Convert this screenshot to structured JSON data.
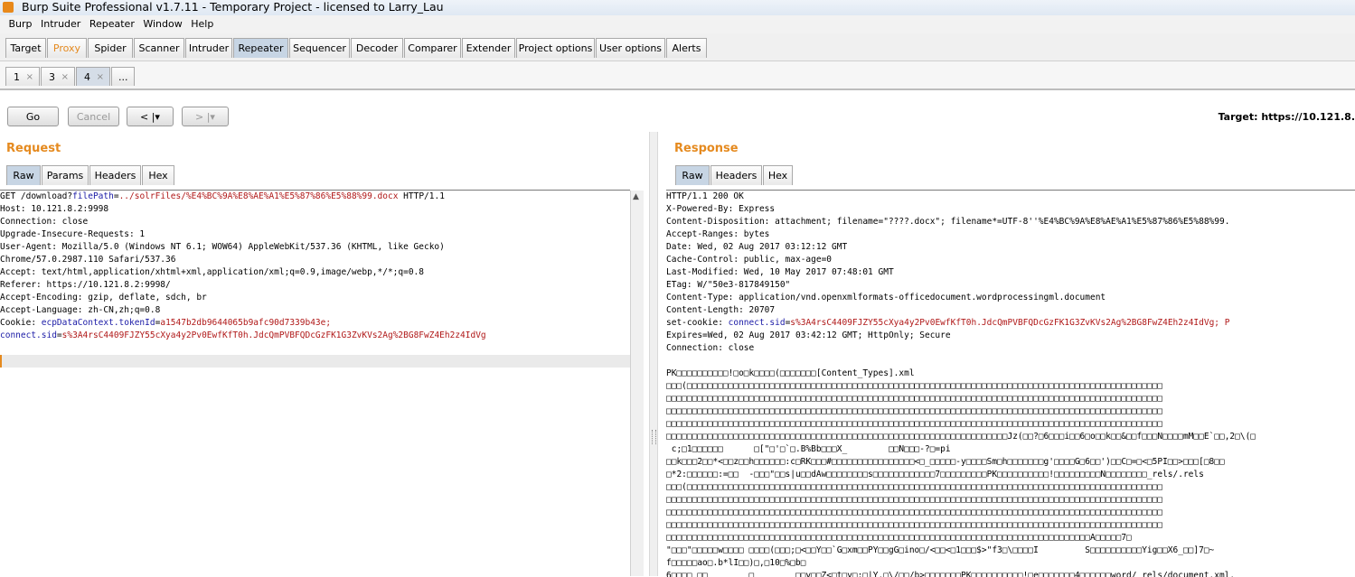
{
  "window": {
    "title": "Burp Suite Professional v1.7.11 - Temporary Project - licensed to Larry_Lau"
  },
  "menu": [
    "Burp",
    "Intruder",
    "Repeater",
    "Window",
    "Help"
  ],
  "main_tabs": [
    "Target",
    "Proxy",
    "Spider",
    "Scanner",
    "Intruder",
    "Repeater",
    "Sequencer",
    "Decoder",
    "Comparer",
    "Extender",
    "Project options",
    "User options",
    "Alerts"
  ],
  "sub_tabs": [
    "1",
    "3",
    "4",
    "..."
  ],
  "sub_tab_close": "×",
  "toolbar": {
    "go_label": "Go",
    "cancel_label": "Cancel",
    "back_label": "< |▾",
    "forward_label": "> |▾",
    "target_label": "Target: https://10.121.8."
  },
  "request": {
    "title": "Request",
    "tabs": [
      "Raw",
      "Params",
      "Headers",
      "Hex"
    ],
    "lines": [
      [
        "GET /download?",
        "filePath",
        "=",
        "../solrFiles/%E4%BC%9A%E8%AE%A1%E5%87%86%E5%88%99.docx",
        " HTTP/1.1"
      ],
      [
        "Host: 10.121.8.2:9998"
      ],
      [
        "Connection: close"
      ],
      [
        "Upgrade-Insecure-Requests: 1"
      ],
      [
        "User-Agent: Mozilla/5.0 (Windows NT 6.1; WOW64) AppleWebKit/537.36 (KHTML, like Gecko)"
      ],
      [
        "Chrome/57.0.2987.110 Safari/537.36"
      ],
      [
        "Accept: text/html,application/xhtml+xml,application/xml;q=0.9,image/webp,*/*;q=0.8"
      ],
      [
        "Referer: https://10.121.8.2:9998/"
      ],
      [
        "Accept-Encoding: gzip, deflate, sdch, br"
      ],
      [
        "Accept-Language: zh-CN,zh;q=0.8"
      ],
      [
        "Cookie: ",
        "ecpDataContext.tokenId",
        "=",
        "a1547b2db9644065b9afc90d7339b43e;"
      ],
      [
        "",
        "connect.sid",
        "=",
        "s%3A4rsC4409FJZY55cXya4y2Pv0EwfKfT0h.JdcQmPVBFQDcGzFK1G3ZvKVs2Ag%2BG8FwZ4Eh2z4IdVg"
      ]
    ]
  },
  "response": {
    "title": "Response",
    "tabs": [
      "Raw",
      "Headers",
      "Hex"
    ],
    "lines": [
      [
        "HTTP/1.1 200 OK"
      ],
      [
        "X-Powered-By: Express"
      ],
      [
        "Content-Disposition: attachment; filename=\"????.docx\"; filename*=UTF-8''%E4%BC%9A%E8%AE%A1%E5%87%86%E5%88%99."
      ],
      [
        "Accept-Ranges: bytes"
      ],
      [
        "Date: Wed, 02 Aug 2017 03:12:12 GMT"
      ],
      [
        "Cache-Control: public, max-age=0"
      ],
      [
        "Last-Modified: Wed, 10 May 2017 07:48:01 GMT"
      ],
      [
        "ETag: W/\"50e3-817849150\""
      ],
      [
        "Content-Type: application/vnd.openxmlformats-officedocument.wordprocessingml.document"
      ],
      [
        "Content-Length: 20707"
      ],
      [
        "set-cookie: ",
        "connect.sid",
        "=",
        "s%3A4rsC4409FJZY55cXya4y2Pv0EwfKfT0h.JdcQmPVBFQDcGzFK1G3ZvKVs2Ag%2BG8FwZ4Eh2z4IdVg; P"
      ],
      [
        "Expires=Wed, 02 Aug 2017 03:42:12 GMT; HttpOnly; Secure"
      ],
      [
        "Connection: close"
      ],
      [
        ""
      ],
      [
        "PK□□□□□□□□□□!□o□k□□□□(□□□□□□□[Content_Types].xml"
      ],
      [
        "□□□(□□□□□□□□□□□□□□□□□□□□□□□□□□□□□□□□□□□□□□□□□□□□□□□□□□□□□□□□□□□□□□□□□□□□□□□□□□□□□□□□□□□□□□□□□□□□"
      ],
      [
        "□□□□□□□□□□□□□□□□□□□□□□□□□□□□□□□□□□□□□□□□□□□□□□□□□□□□□□□□□□□□□□□□□□□□□□□□□□□□□□□□□□□□□□□□□□□□□□□□"
      ],
      [
        "□□□□□□□□□□□□□□□□□□□□□□□□□□□□□□□□□□□□□□□□□□□□□□□□□□□□□□□□□□□□□□□□□□□□□□□□□□□□□□□□□□□□□□□□□□□□□□□□"
      ],
      [
        "□□□□□□□□□□□□□□□□□□□□□□□□□□□□□□□□□□□□□□□□□□□□□□□□□□□□□□□□□□□□□□□□□□□□□□□□□□□□□□□□□□□□□□□□□□□□□□□□"
      ],
      [
        "□□□□□□□□□□□□□□□□□□□□□□□□□□□□□□□□□□□□□□□□□□□□□□□□□□□□□□□□□□□□□□□□□□Jz(□□?□6□□□i□□6□o□□k□□&□□f□□□N□□□□mM□□E`□□,2□\\(□"
      ],
      [
        " c;□1□□□□□□      □[\"□'□`□.B%Bb□□□X_        □□N□□□-?□=pi"
      ],
      [
        "□□k□□□2□□*<□□z□□h□□□□□□:c□RK□□□#□□□□□□□□□□□□□□□□<□_□□□□□-y□□□□Sm□h□□□□□□□g'□□□□G□6□□')□□C□=□<□5PI□□>□□□[□8□□"
      ],
      [
        "□*2:□□□□□□:=□□  -□□□\"□□s|u□□dAw□□□□□□□□s□□□□□□□□□□□□7□□□□□□□□□PK□□□□□□□□□□!□□□□□□□□□N□□□□□□□□_rels/.rels"
      ],
      [
        "□□□(□□□□□□□□□□□□□□□□□□□□□□□□□□□□□□□□□□□□□□□□□□□□□□□□□□□□□□□□□□□□□□□□□□□□□□□□□□□□□□□□□□□□□□□□□□□□"
      ],
      [
        "□□□□□□□□□□□□□□□□□□□□□□□□□□□□□□□□□□□□□□□□□□□□□□□□□□□□□□□□□□□□□□□□□□□□□□□□□□□□□□□□□□□□□□□□□□□□□□□□"
      ],
      [
        "□□□□□□□□□□□□□□□□□□□□□□□□□□□□□□□□□□□□□□□□□□□□□□□□□□□□□□□□□□□□□□□□□□□□□□□□□□□□□□□□□□□□□□□□□□□□□□□□"
      ],
      [
        "□□□□□□□□□□□□□□□□□□□□□□□□□□□□□□□□□□□□□□□□□□□□□□□□□□□□□□□□□□□□□□□□□□□□□□□□□□□□□□□□□□□□□□□□□□□□□□□□"
      ],
      [
        "□□□□□□□□□□□□□□□□□□□□□□□□□□□□□□□□□□□□□□□□□□□□□□□□□□□□□□□□□□□□□□□□□□□□□□□□□□□□□□□□□□A□□□□□7□"
      ],
      [
        "\"□□□\"□□□□□w□□□□ □□□□(□□□;□<□□Y□□`G□xm□□PY□□gG□ino□/<□□<□1□□□$>\"f3□\\□□□□I         S□□□□□□□□□□Yig□□X6_□□]7□~"
      ],
      [
        "f□□□□□ao□.b*lI□□)□,□10□%□b□"
      ],
      [
        "6□□□□ □□        □        □□y□□Z<□t□y□:□|Y.□\\/□□/b>□□□□□□□PK□□□□□□□□□□!□e□□□□□□□4□□□□□□word/_rels/document.xml."
      ]
    ]
  }
}
